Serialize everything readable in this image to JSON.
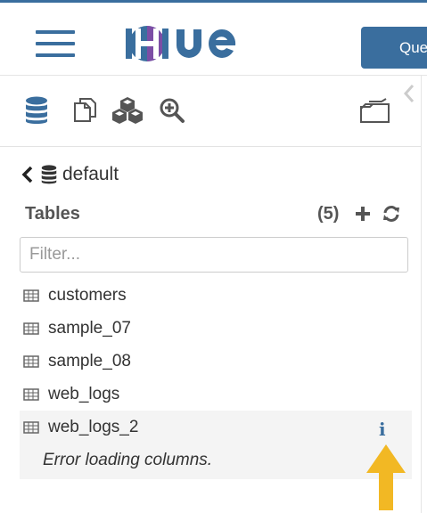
{
  "app": {
    "logo_text": "HUE",
    "query_button_label": "Query"
  },
  "colors": {
    "brand": "#3a6e9e",
    "logo_purple": "#7c4da5",
    "arrow": "#f2b824",
    "icon_grey": "#555555"
  },
  "icon_bar": {
    "icons": [
      "database-icon",
      "documents-icon",
      "cubes-icon",
      "zoom-in-icon",
      "folder-icon"
    ]
  },
  "breadcrumb": {
    "back_icon": "chevron-left-icon",
    "db_icon": "database-icon",
    "label": "default"
  },
  "tables_header": {
    "title": "Tables",
    "count": "(5)",
    "add_icon": "plus-icon",
    "refresh_icon": "refresh-icon"
  },
  "filter": {
    "placeholder": "Filter...",
    "value": ""
  },
  "tables": [
    {
      "name": "customers"
    },
    {
      "name": "sample_07"
    },
    {
      "name": "sample_08"
    },
    {
      "name": "web_logs"
    },
    {
      "name": "web_logs_2"
    }
  ],
  "selected": {
    "info_icon": "info-icon",
    "error": "Error loading columns."
  }
}
